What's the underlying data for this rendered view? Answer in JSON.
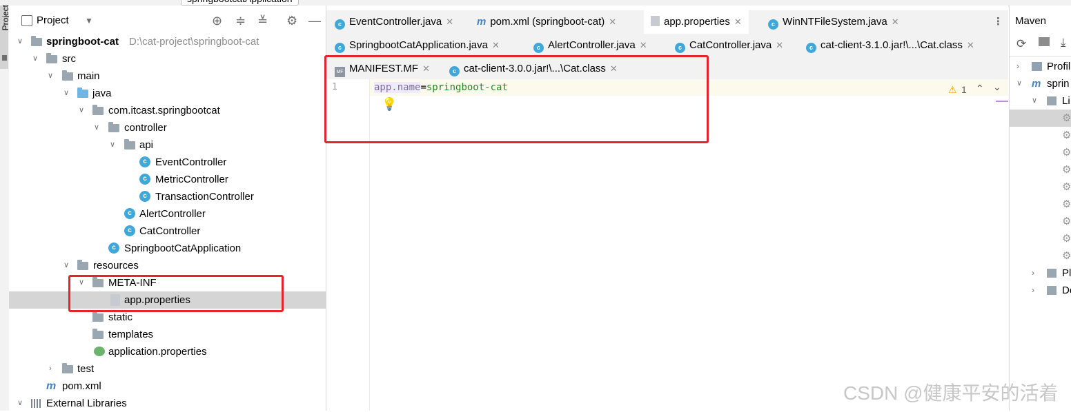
{
  "topbar": {
    "run_config": "springbootcatApplication"
  },
  "left_stripe": {
    "label": "Project"
  },
  "project": {
    "header_title": "Project",
    "tree": [
      {
        "label": "springboot-cat",
        "path": "D:\\cat-project\\springboot-cat"
      },
      {
        "label": "src"
      },
      {
        "label": "main"
      },
      {
        "label": "java"
      },
      {
        "label": "com.itcast.springbootcat"
      },
      {
        "label": "controller"
      },
      {
        "label": "api"
      },
      {
        "label": "EventController"
      },
      {
        "label": "MetricController"
      },
      {
        "label": "TransactionController"
      },
      {
        "label": "AlertController"
      },
      {
        "label": "CatController"
      },
      {
        "label": "SpringbootCatApplication"
      },
      {
        "label": "resources"
      },
      {
        "label": "META-INF"
      },
      {
        "label": "app.properties"
      },
      {
        "label": "static"
      },
      {
        "label": "templates"
      },
      {
        "label": "application.properties"
      },
      {
        "label": "test"
      },
      {
        "label": "pom.xml"
      },
      {
        "label": "External Libraries"
      }
    ]
  },
  "editor": {
    "tabs_row1": [
      "EventController.java",
      "pom.xml (springboot-cat)",
      "app.properties",
      "WinNTFileSystem.java"
    ],
    "tabs_row2": [
      "SpringbootCatApplication.java",
      "AlertController.java",
      "CatController.java",
      "cat-client-3.1.0.jar!\\...\\Cat.class"
    ],
    "tabs_row3": [
      "MANIFEST.MF",
      "cat-client-3.0.0.jar!\\...\\Cat.class"
    ],
    "line_number": "1",
    "code_key": "app.name",
    "code_eq": "=",
    "code_value": "springboot-cat",
    "warning_count": "1"
  },
  "maven": {
    "title": "Maven",
    "items": [
      "Profil",
      "sprin",
      "Li",
      "Pl",
      "De"
    ]
  },
  "watermark": "CSDN @健康平安的活着",
  "colors": {
    "accent": "#4083c9",
    "highlight_box": "#e4232a",
    "selection": "#d5d5d5",
    "class_icon": "#40a8d9"
  }
}
